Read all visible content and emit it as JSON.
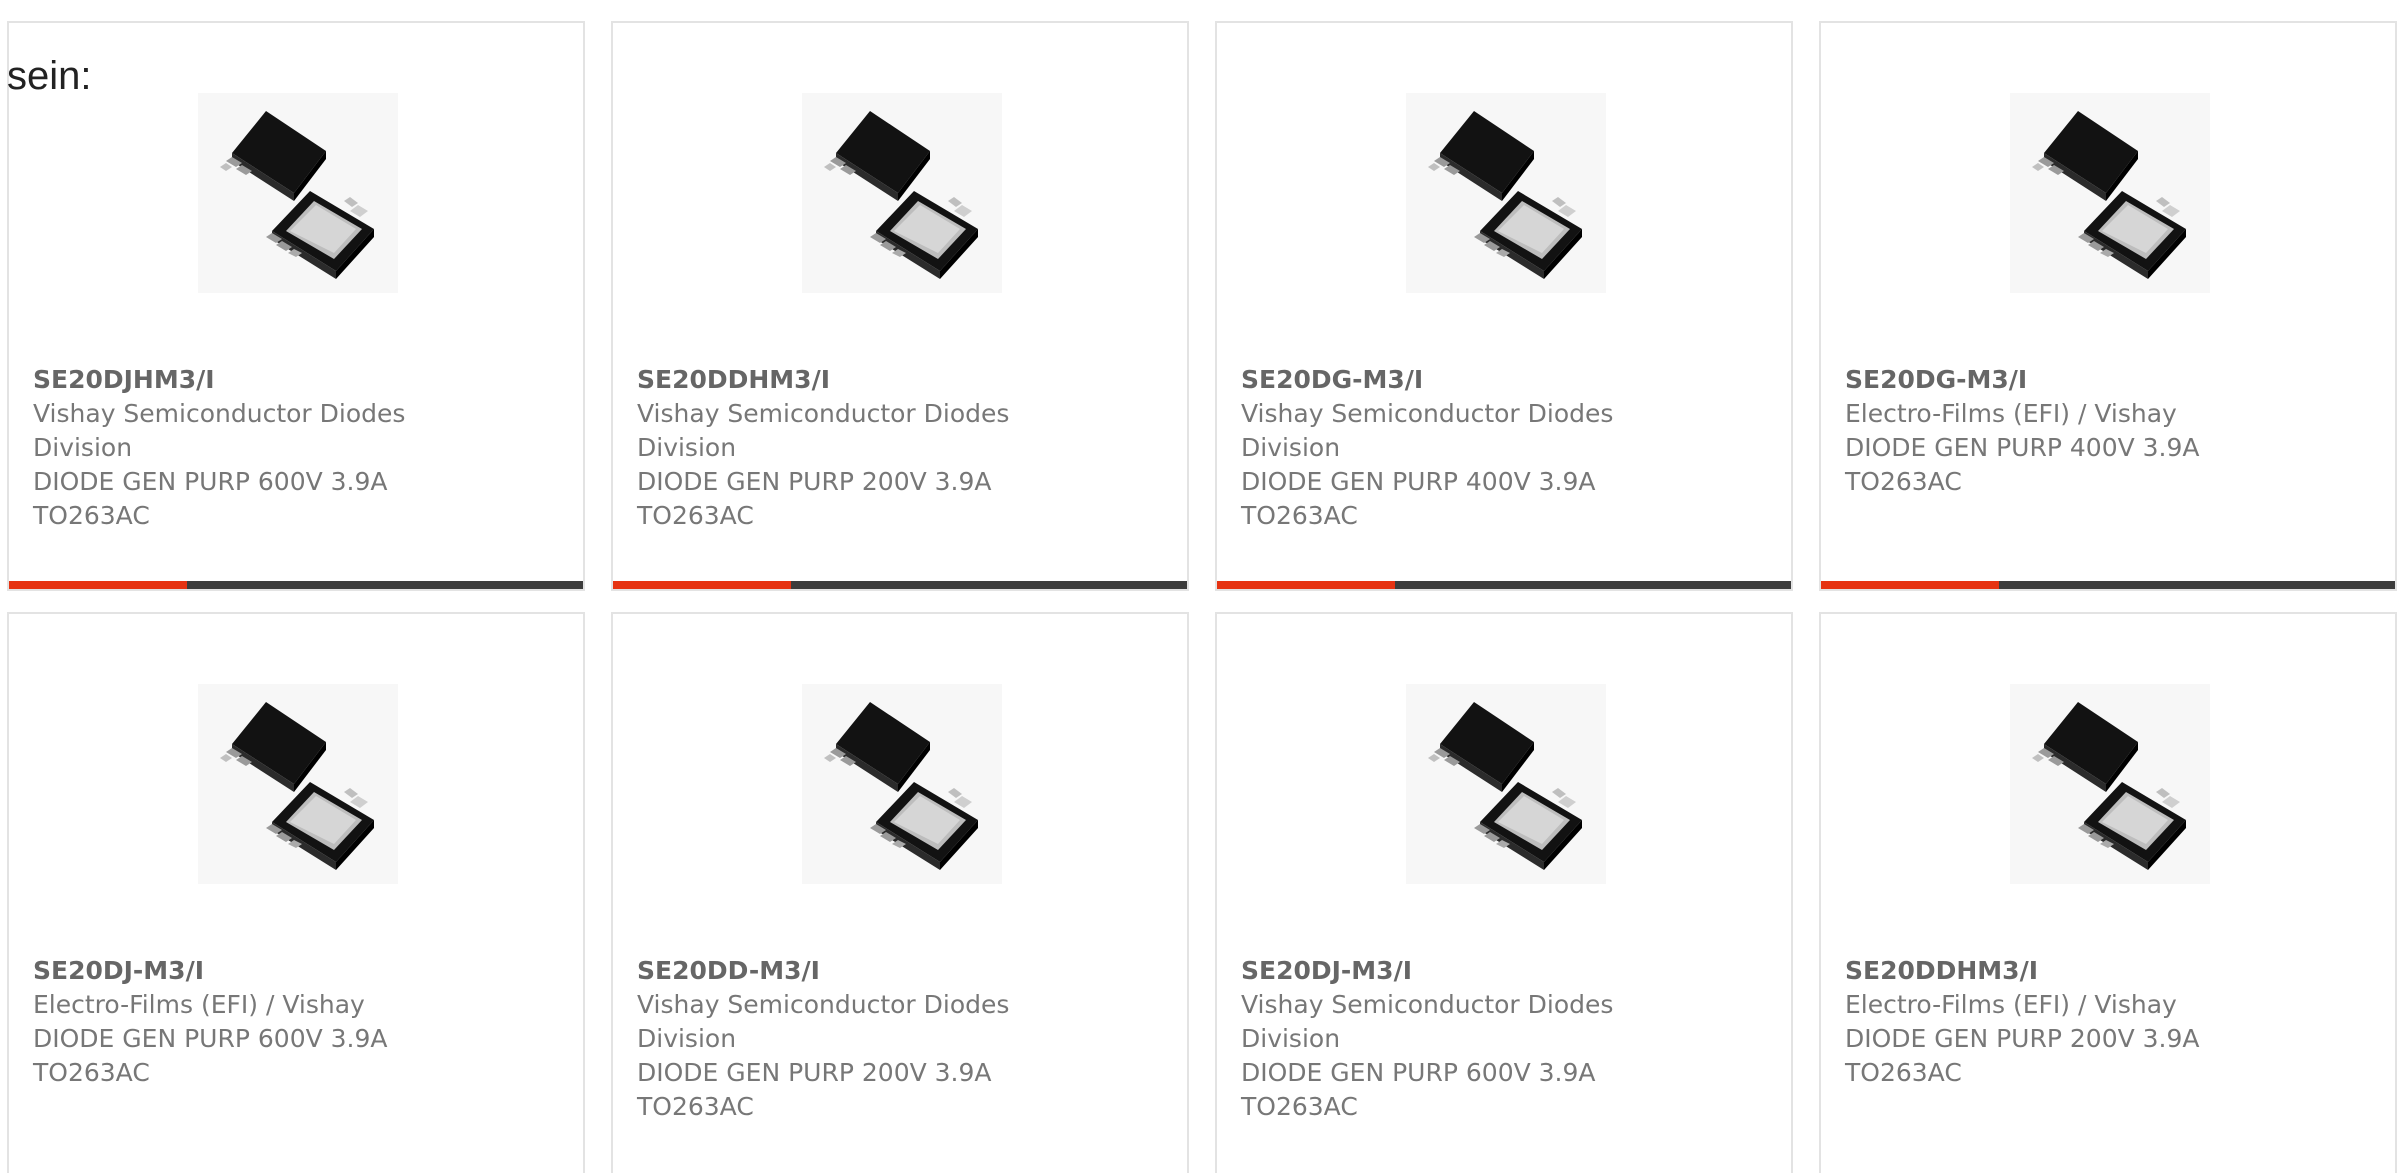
{
  "intro_text": "sein:",
  "accent_color": "#e63312",
  "bar_color": "#3c3c3c",
  "bar_fill_fraction": 0.31,
  "product_icon": "to263-diode-package",
  "products": [
    {
      "part": "SE20DJHM3/I",
      "manufacturer": "Vishay Semiconductor Diodes Division",
      "desc": "DIODE GEN PURP 600V 3.9A TO263AC"
    },
    {
      "part": "SE20DDHM3/I",
      "manufacturer": "Vishay Semiconductor Diodes Division",
      "desc": "DIODE GEN PURP 200V 3.9A TO263AC"
    },
    {
      "part": "SE20DG-M3/I",
      "manufacturer": "Vishay Semiconductor Diodes Division",
      "desc": "DIODE GEN PURP 400V 3.9A TO263AC"
    },
    {
      "part": "SE20DG-M3/I",
      "manufacturer": "Electro-Films (EFI) / Vishay",
      "desc": "DIODE GEN PURP 400V 3.9A TO263AC"
    },
    {
      "part": "SE20DJ-M3/I",
      "manufacturer": "Electro-Films (EFI) / Vishay",
      "desc": "DIODE GEN PURP 600V 3.9A TO263AC"
    },
    {
      "part": "SE20DD-M3/I",
      "manufacturer": "Vishay Semiconductor Diodes Division",
      "desc": "DIODE GEN PURP 200V 3.9A TO263AC"
    },
    {
      "part": "SE20DJ-M3/I",
      "manufacturer": "Vishay Semiconductor Diodes Division",
      "desc": "DIODE GEN PURP 600V 3.9A TO263AC"
    },
    {
      "part": "SE20DDHM3/I",
      "manufacturer": "Electro-Films (EFI) / Vishay",
      "desc": "DIODE GEN PURP 200V 3.9A TO263AC"
    }
  ]
}
